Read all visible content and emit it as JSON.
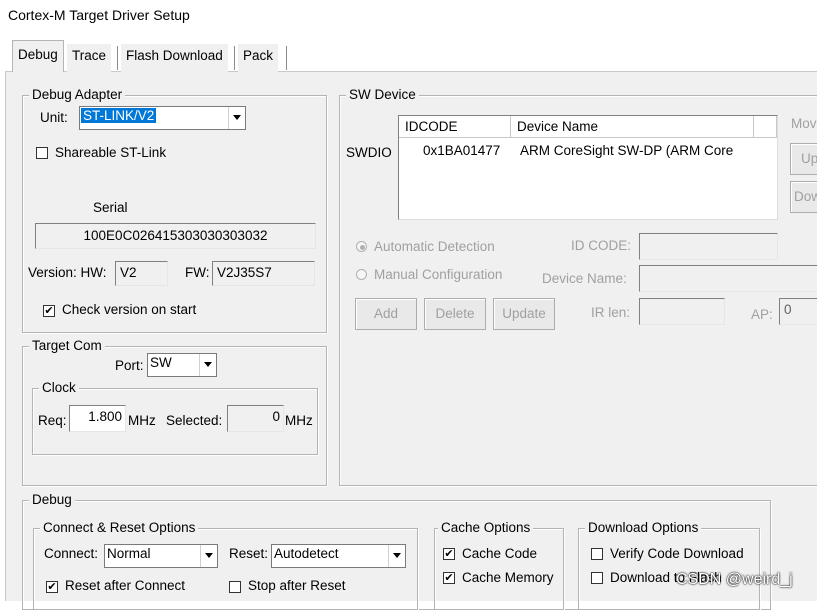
{
  "window": {
    "title": "Cortex-M Target Driver Setup"
  },
  "tabs": [
    {
      "label": "Debug",
      "active": true
    },
    {
      "label": "Trace"
    },
    {
      "label": "Flash Download"
    },
    {
      "label": "Pack"
    }
  ],
  "debug_adapter": {
    "group_label": "Debug Adapter",
    "unit_label": "Unit:",
    "unit_value": "ST-LINK/V2",
    "shareable_label": "Shareable ST-Link",
    "shareable_checked": false,
    "serial_label": "Serial",
    "serial_value": "100E0C026415303030303032",
    "version_label": "Version: HW:",
    "hw_value": "V2",
    "fw_label": "FW:",
    "fw_value": "V2J35S7",
    "check_version_label": "Check version on start",
    "check_version_checked": true
  },
  "target_com": {
    "group_label": "Target Com",
    "port_label": "Port:",
    "port_value": "SW",
    "clock": {
      "group_label": "Clock",
      "req_label": "Req:",
      "req_value": "1.800",
      "req_unit": "MHz",
      "selected_label": "Selected:",
      "selected_value": "0",
      "selected_unit": "MHz"
    }
  },
  "sw_device": {
    "group_label": "SW Device",
    "row_label": "SWDIO",
    "columns": [
      "IDCODE",
      "Device Name"
    ],
    "rows": [
      {
        "idcode": "0x1BA01477",
        "device_name": "ARM CoreSight SW-DP (ARM Core"
      }
    ],
    "move_label": "Mov",
    "up_label": "Up",
    "down_label": "Dow",
    "auto_detect_label": "Automatic Detection",
    "manual_config_label": "Manual Configuration",
    "id_code_label": "ID CODE:",
    "device_name_label": "Device Name:",
    "ir_len_label": "IR len:",
    "ap_label": "AP:",
    "ap_value": "0",
    "add_label": "Add",
    "delete_label": "Delete",
    "update_label": "Update"
  },
  "debug": {
    "group_label": "Debug",
    "connect_reset": {
      "group_label": "Connect & Reset Options",
      "connect_label": "Connect:",
      "connect_value": "Normal",
      "reset_label": "Reset:",
      "reset_value": "Autodetect",
      "reset_after_connect_label": "Reset after Connect",
      "reset_after_connect_checked": true,
      "stop_after_reset_label": "Stop after Reset",
      "stop_after_reset_checked": false
    },
    "cache": {
      "group_label": "Cache Options",
      "cache_code_label": "Cache Code",
      "cache_code_checked": true,
      "cache_memory_label": "Cache Memory",
      "cache_memory_checked": true
    },
    "download": {
      "group_label": "Download Options",
      "verify_label": "Verify Code Download",
      "verify_checked": false,
      "download_to_flash_label": "Download to Flash",
      "download_to_flash_checked": false
    }
  },
  "watermark": "CSDN @weird_j",
  "check_mark": "✔"
}
